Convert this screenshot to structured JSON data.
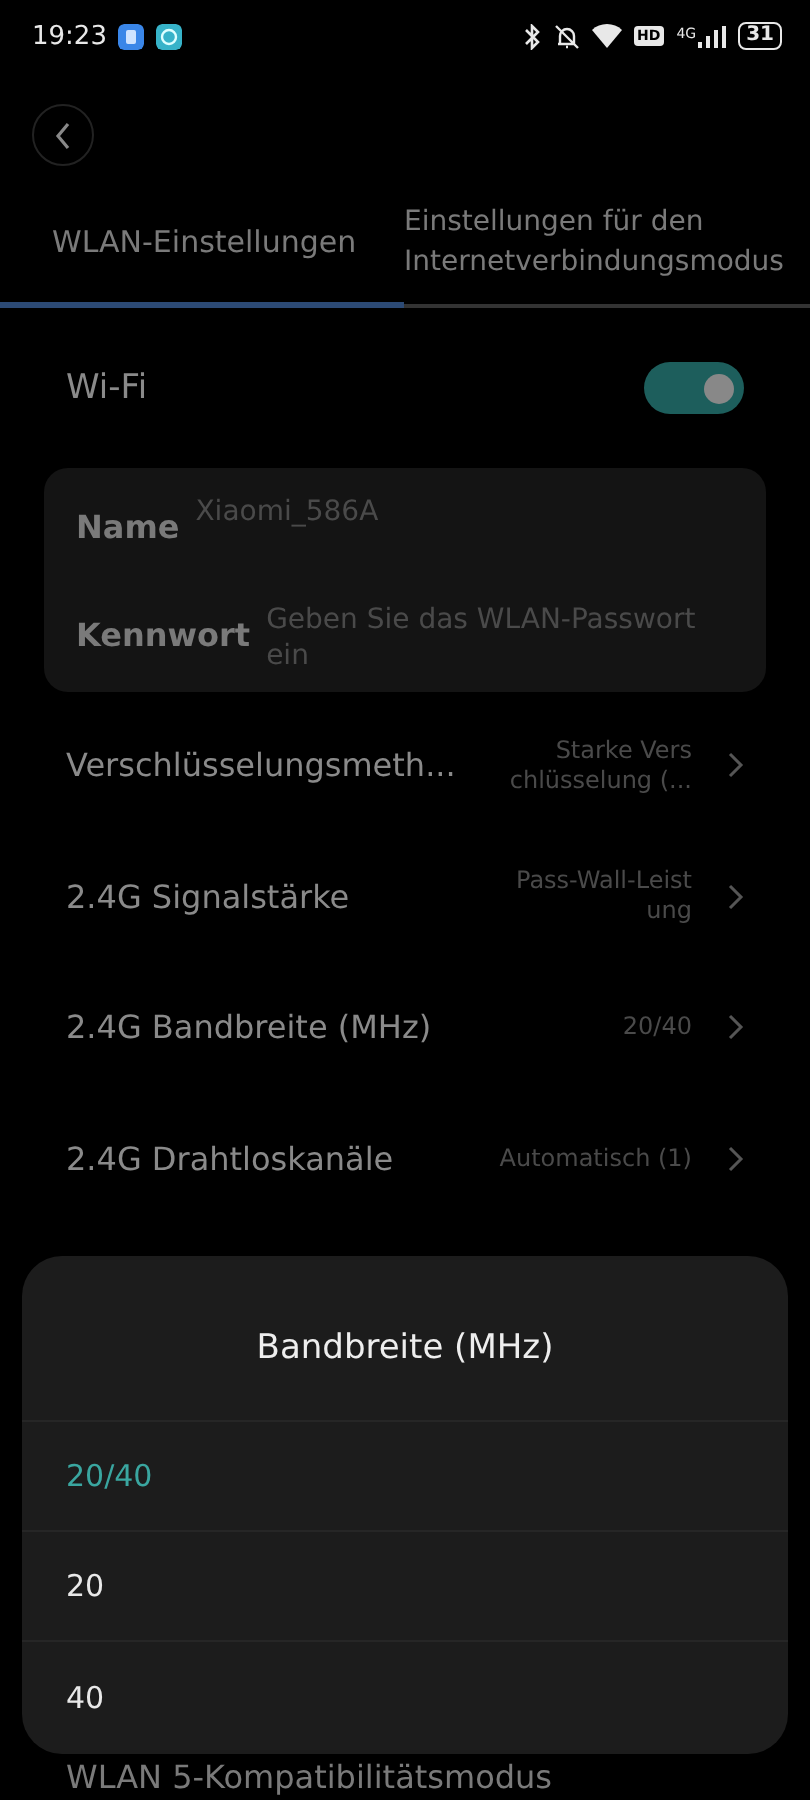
{
  "status_bar": {
    "time": "19:23",
    "network": "4G",
    "hd": "HD",
    "battery": "31"
  },
  "tabs": [
    {
      "label": "WLAN-Einstellungen",
      "selected": true
    },
    {
      "label": "Einstellungen für den Internetverbindungsmodus",
      "selected": false
    }
  ],
  "wifi": {
    "label": "Wi-Fi",
    "on": true
  },
  "credentials": [
    {
      "label": "Name",
      "value": "Xiaomi_586A"
    },
    {
      "label": "Kennwort",
      "placeholder": "Geben Sie das WLAN-Passwort ein"
    }
  ],
  "settings": [
    {
      "label": "Verschlüsselungsmeth...",
      "value": "Starke Vers chlüsselung (..."
    },
    {
      "label": "2.4G Signalstärke",
      "value": "Pass-Wall-Leist ung"
    },
    {
      "label": "2.4G Bandbreite (MHz)",
      "value": "20/40"
    },
    {
      "label": "2.4G Drahtloskanäle",
      "value": "Automatisch (1)"
    }
  ],
  "below_sheet": "WLAN 5-Kompatibilitätsmodus",
  "sheet": {
    "title": "Bandbreite (MHz)",
    "options": [
      {
        "label": "20/40",
        "selected": true
      },
      {
        "label": "20",
        "selected": false
      },
      {
        "label": "40",
        "selected": false
      }
    ]
  }
}
